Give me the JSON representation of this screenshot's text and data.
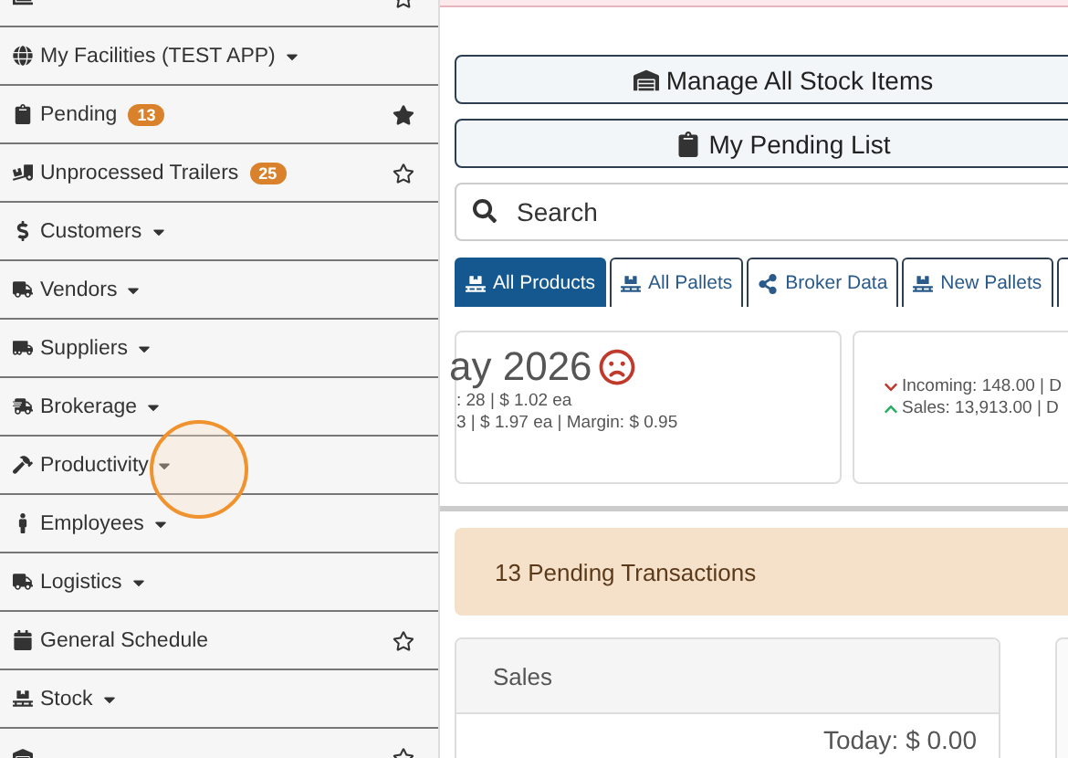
{
  "sidebar": {
    "items": [
      {
        "kind": "link",
        "starred": false
      },
      {
        "kind": "dropdown",
        "label": "My Facilities (TEST APP)"
      },
      {
        "kind": "link",
        "label": "Pending",
        "badge": "13",
        "starred": true
      },
      {
        "kind": "link",
        "label": "Unprocessed Trailers",
        "badge": "25",
        "starred": false
      },
      {
        "kind": "dropdown",
        "label": "Customers"
      },
      {
        "kind": "dropdown",
        "label": "Vendors"
      },
      {
        "kind": "dropdown",
        "label": "Suppliers"
      },
      {
        "kind": "dropdown",
        "label": "Brokerage"
      },
      {
        "kind": "dropdown",
        "label": "Productivity"
      },
      {
        "kind": "dropdown",
        "label": "Employees"
      },
      {
        "kind": "dropdown",
        "label": "Logistics"
      },
      {
        "kind": "link",
        "label": "General Schedule",
        "starred": false
      },
      {
        "kind": "dropdown",
        "label": "Stock"
      },
      {
        "kind": "link",
        "starred": false
      }
    ]
  },
  "buttons": [
    "Manage All Stock Items",
    "My Pending List"
  ],
  "search": {
    "placeholder": "Search"
  },
  "tabs": [
    {
      "label": "All Products",
      "selected": true
    },
    {
      "label": "All Pallets",
      "selected": false
    },
    {
      "label": "Broker Data",
      "selected": false
    },
    {
      "label": "New Pallets",
      "selected": false
    },
    {
      "selected": false
    }
  ],
  "summary_cards": [
    {
      "title": "ay 2026",
      "sad_face": true,
      "lines": [
        {
          "kind": "plain",
          "text": ": 28 | $ 1.02 ea"
        },
        {
          "kind": "plain",
          "text": "3 | $ 1.97 ea | Margin: $ 0.95"
        }
      ]
    },
    {
      "sad_face": false,
      "lines": [
        {
          "kind": "down",
          "text": "Incoming: 148.00 | D"
        },
        {
          "kind": "up",
          "text": "Sales: 13,913.00 | D"
        }
      ]
    }
  ],
  "alert": {
    "text": "13 Pending Transactions"
  },
  "panels": [
    {
      "title": "Sales",
      "value": "Today: $ 0.00"
    }
  ]
}
